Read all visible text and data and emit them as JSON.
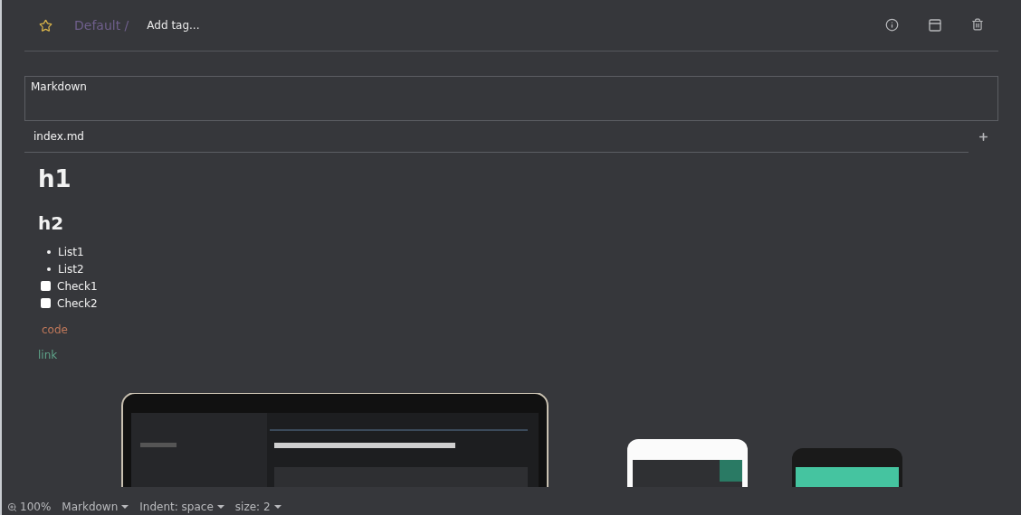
{
  "header": {
    "starred": false,
    "folder": "Default /",
    "tag_placeholder": "Add tag..."
  },
  "title": {
    "value": "Markdown"
  },
  "snippet_tabs": [
    {
      "label": "index.md",
      "selected": true
    }
  ],
  "preview": {
    "h1": "h1",
    "h2": "h2",
    "list": [
      "List1",
      "List2"
    ],
    "checks": [
      {
        "label": "Check1",
        "checked": false
      },
      {
        "label": "Check2",
        "checked": false
      }
    ],
    "code": "code",
    "link": "link"
  },
  "status_bar": {
    "zoom": "100%",
    "mode": "Markdown",
    "indent": "Indent: space",
    "size": "size: 2"
  }
}
